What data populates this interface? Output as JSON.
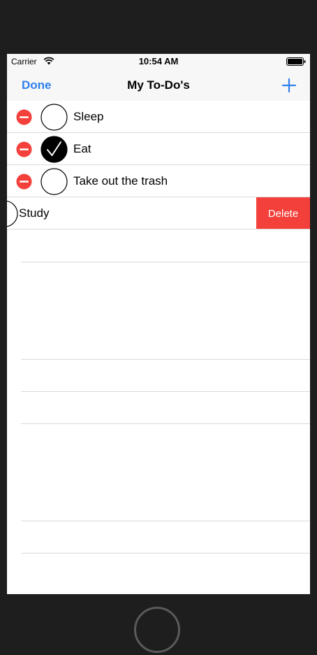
{
  "status_bar": {
    "carrier": "Carrier",
    "time": "10:54 AM",
    "icons": [
      "wifi-icon",
      "battery-icon"
    ]
  },
  "nav": {
    "done_label": "Done",
    "title": "My To-Do's",
    "add_icon": "plus-icon"
  },
  "todos": [
    {
      "label": "Sleep",
      "done": false
    },
    {
      "label": "Eat",
      "done": true
    },
    {
      "label": "Take out the trash",
      "done": false
    },
    {
      "label": "Study",
      "done": false
    }
  ],
  "swipe_action": {
    "label": "Delete"
  },
  "colors": {
    "accent": "#2f80ed",
    "destructive": "#f4403b",
    "bar_background": "#f7f7f7"
  }
}
